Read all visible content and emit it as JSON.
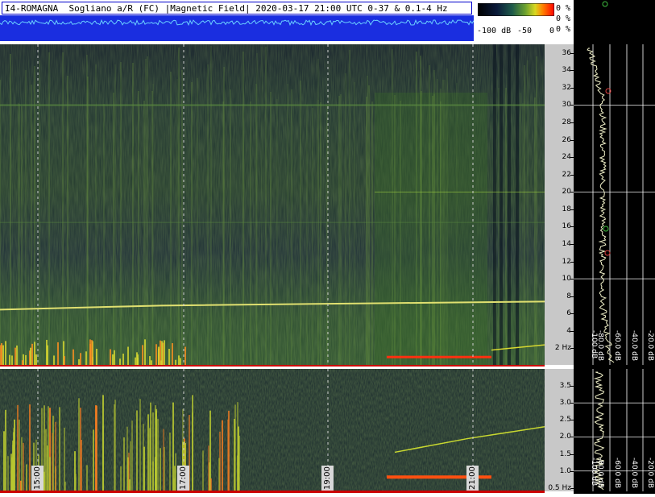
{
  "header": {
    "title": "I4-ROMAGNA  Sogliano a/R (FC) |Magnetic Field| 2020-03-17 21:00 UTC 0-37 & 0.1-4 Hz"
  },
  "colorbar": {
    "min_label": "-100 dB",
    "mid_label": "-50",
    "max_label": "0",
    "pct_labels": [
      "0 %",
      "0 %",
      "0 %"
    ],
    "colors": [
      "#000000",
      "#0a1a3a",
      "#1e5a4a",
      "#6aa030",
      "#d8d820",
      "#ff8000",
      "#ff0000"
    ]
  },
  "chart_data": [
    {
      "type": "heatmap",
      "title": "",
      "xlabel": "",
      "ylabel": "",
      "ylim": [
        0,
        37
      ],
      "y_ticks": [
        "2 Hz",
        "4",
        "6",
        "8",
        "10",
        "12",
        "14",
        "16",
        "18",
        "20",
        "22",
        "24",
        "26",
        "28",
        "30",
        "32",
        "34",
        "36"
      ],
      "y_tick_values": [
        2,
        4,
        6,
        8,
        10,
        12,
        14,
        16,
        18,
        20,
        22,
        24,
        26,
        28,
        30,
        32,
        34,
        36
      ],
      "x_ticks": [
        "15:00",
        "17:00",
        "19:00",
        "21:00"
      ],
      "grid": true
    },
    {
      "type": "heatmap",
      "title": "",
      "ylim": [
        0.4,
        4
      ],
      "y_ticks": [
        "0.5 Hz",
        "1.0",
        "1.5",
        "2.0",
        "2.5",
        "3.0",
        "3.5"
      ],
      "y_tick_values": [
        0.5,
        1.0,
        1.5,
        2.0,
        2.5,
        3.0,
        3.5
      ],
      "grid": true
    },
    {
      "type": "line",
      "title": "",
      "x_ticks": [
        "-100 dB",
        "-80.0 dB",
        "-60.0 dB",
        "-40.0 dB",
        "-20.0 dB"
      ],
      "grid": true
    }
  ],
  "colors": {
    "background": "#1b2a3a",
    "trace": "#e0e0a0",
    "red_marker": "#cc0000",
    "waveform_blue": "#1a3adf"
  }
}
